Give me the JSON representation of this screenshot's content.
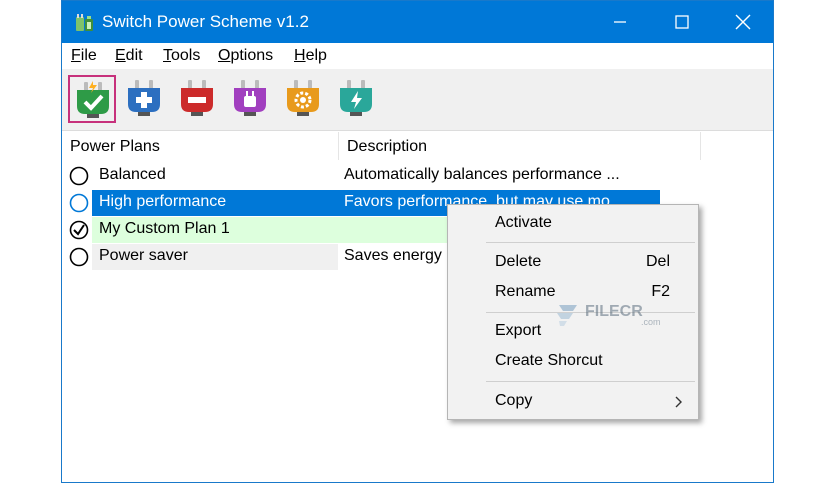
{
  "window": {
    "title": "Switch Power Scheme v1.2",
    "titlebar_color": "#0078d7",
    "controls": {
      "minimize_icon": "minimize-icon",
      "maximize_icon": "maximize-icon",
      "close_icon": "close-icon"
    }
  },
  "menu": [
    {
      "mnemonic": "F",
      "rest": "ile"
    },
    {
      "mnemonic": "E",
      "rest": "dit"
    },
    {
      "mnemonic": "T",
      "rest": "ools"
    },
    {
      "mnemonic": "O",
      "rest": "ptions"
    },
    {
      "mnemonic": "H",
      "rest": "elp"
    }
  ],
  "toolbar": {
    "buttons": [
      {
        "icon": "plug-check-icon",
        "color": "#2e9b47",
        "active": true
      },
      {
        "icon": "plug-add-icon",
        "color": "#2c6fc0"
      },
      {
        "icon": "plug-remove-icon",
        "color": "#cc2b2b"
      },
      {
        "icon": "plug-rename-icon",
        "color": "#a13fbf"
      },
      {
        "icon": "plug-settings-icon",
        "color": "#e89a1c"
      },
      {
        "icon": "plug-power-icon",
        "color": "#2aa79a"
      }
    ]
  },
  "list": {
    "columns": [
      "Power Plans",
      "Description"
    ],
    "rows": [
      {
        "name": "Balanced",
        "description": "Automatically balances performance ...",
        "state": "normal"
      },
      {
        "name": "High performance",
        "description": "Favors performance, but may use mo...",
        "state": "selected"
      },
      {
        "name": "My Custom Plan 1",
        "description": "",
        "state": "active"
      },
      {
        "name": "Power saver",
        "description": "Saves energy",
        "state": "normal"
      }
    ],
    "selected_color": "#0078d7",
    "active_color": "#ddffdd"
  },
  "context_menu": {
    "items": [
      {
        "label": "Activate",
        "shortcut": ""
      },
      {
        "label": "Delete",
        "shortcut": "Del"
      },
      {
        "label": "Rename",
        "shortcut": "F2"
      },
      {
        "label": "Export",
        "shortcut": ""
      },
      {
        "label": "Create Shorcut",
        "shortcut": ""
      },
      {
        "label": "Copy",
        "shortcut": "",
        "submenu_icon": "chevron-right-icon"
      }
    ]
  },
  "watermark": {
    "text": "FILECR",
    "suffix": ".com"
  }
}
